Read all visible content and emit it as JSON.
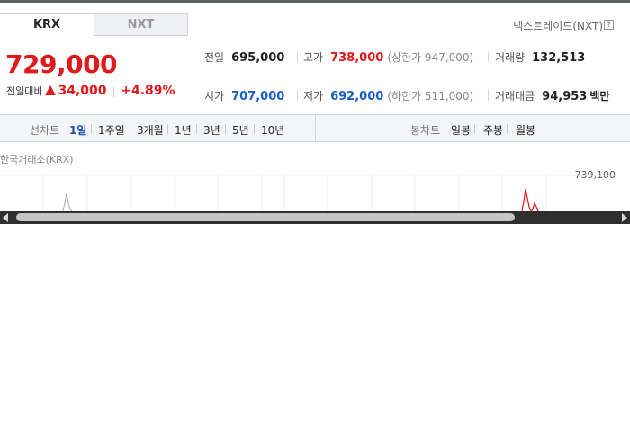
{
  "tabs": [
    {
      "label": "KRX",
      "active": true
    },
    {
      "label": "NXT",
      "active": false
    }
  ],
  "nxt_link": "넥스트레이드(NXT)",
  "help_icon": "?",
  "price": {
    "current": "729,000",
    "change_label": "전일대비",
    "change": "34,000",
    "change_pct": "+4.89%",
    "direction": "up",
    "up_color": "#e0191e"
  },
  "stats": {
    "prev_close": {
      "label": "전일",
      "value": "695,000"
    },
    "high": {
      "label": "고가",
      "value": "738,000",
      "sub": "(상한가 947,000)"
    },
    "volume": {
      "label": "거래량",
      "value": "132,513"
    },
    "open": {
      "label": "시가",
      "value": "707,000"
    },
    "low": {
      "label": "저가",
      "value": "692,000",
      "sub": "(하한가 511,000)"
    },
    "trade_value": {
      "label": "거래대금",
      "value": "94,953",
      "unit": "백만"
    }
  },
  "line_chart": {
    "label": "선차트",
    "periods": [
      "1일",
      "1주일",
      "3개월",
      "1년",
      "3년",
      "5년",
      "10년"
    ],
    "selected": "1일"
  },
  "candle_chart": {
    "label": "봉차트",
    "periods": [
      "일봉",
      "주봉",
      "월봉"
    ]
  },
  "exchange_label": "한국거래소(KRX)",
  "chart_max_label": "739,100",
  "colors": {
    "up": "#e0191e",
    "down": "#1a5dc5",
    "selected_period": "#1a4fb5"
  }
}
